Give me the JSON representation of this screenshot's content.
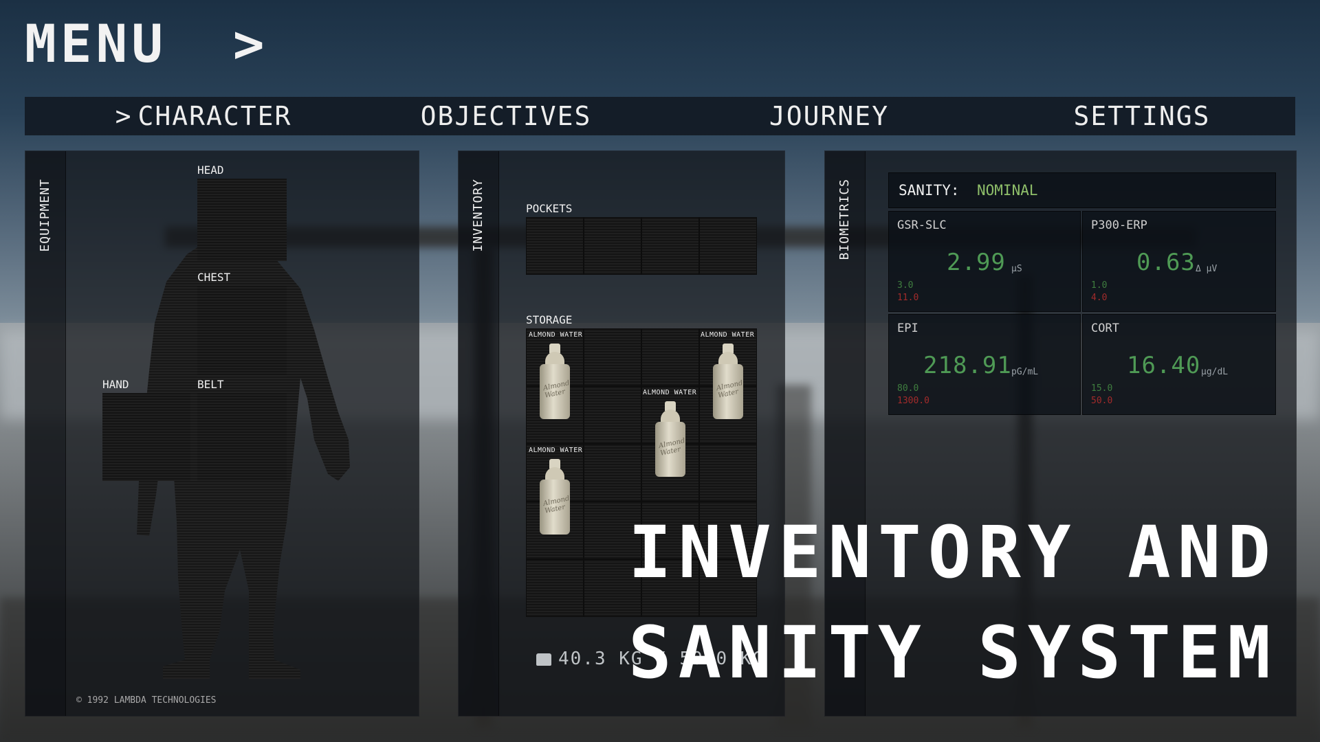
{
  "menu": {
    "title": "MENU",
    "chevron": ">"
  },
  "tabs": [
    {
      "label": "CHARACTER",
      "active": true,
      "marker": ">"
    },
    {
      "label": "OBJECTIVES",
      "active": false
    },
    {
      "label": "JOURNEY",
      "active": false
    },
    {
      "label": "SETTINGS",
      "active": false
    }
  ],
  "equipment": {
    "label": "EQUIPMENT",
    "slots": {
      "head": "HEAD",
      "chest": "CHEST",
      "hand": "HAND",
      "belt": "BELT"
    },
    "copyright": "© 1992 LAMBDA TECHNOLOGIES"
  },
  "inventory": {
    "label": "INVENTORY",
    "pockets_label": "POCKETS",
    "storage_label": "STORAGE",
    "items": [
      "ALMOND WATER",
      "ALMOND WATER",
      "ALMOND WATER",
      "ALMOND WATER"
    ],
    "bottle_script": "Almond Water",
    "weight": "40.3 KG / 50.0 KG"
  },
  "biometrics": {
    "label": "BIOMETRICS",
    "sanity_label": "SANITY:",
    "sanity_value": "NOMINAL",
    "sanity_color": "#8fbf6a",
    "metrics": [
      {
        "name": "GSR-SLC",
        "value": "2.99",
        "unit": "μS",
        "low": "3.0",
        "high": "11.0"
      },
      {
        "name": "P300-ERP",
        "value": "0.63",
        "unit": "Δ μV",
        "low": "1.0",
        "high": "4.0"
      },
      {
        "name": "EPI",
        "value": "218.91",
        "unit": "pG/mL",
        "low": "80.0",
        "high": "1300.0"
      },
      {
        "name": "CORT",
        "value": "16.40",
        "unit": "μg/dL",
        "low": "15.0",
        "high": "50.0"
      }
    ]
  },
  "overlay": {
    "line1": "INVENTORY AND",
    "line2": "SANITY SYSTEM"
  }
}
